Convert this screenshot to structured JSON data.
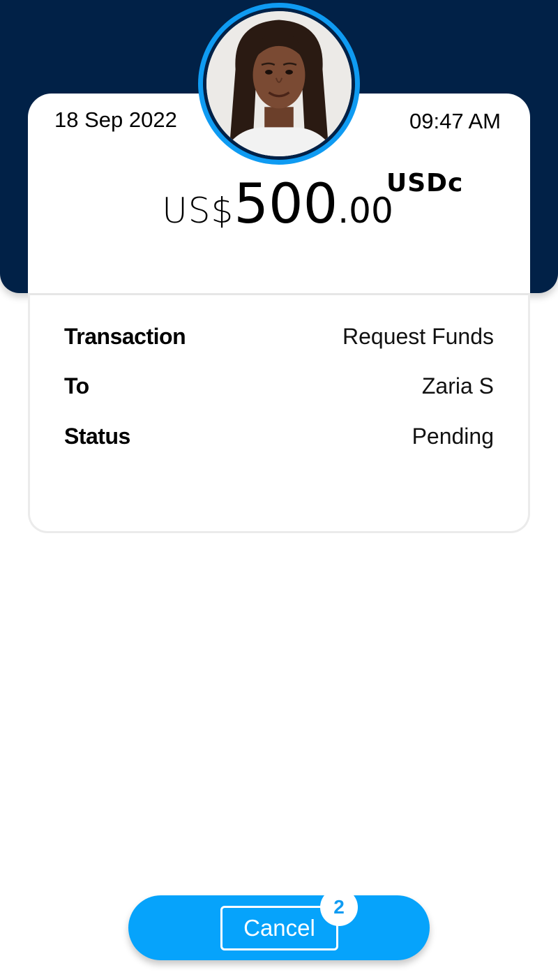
{
  "transaction_card": {
    "date": "18 Sep 2022",
    "time": "09:47 AM",
    "amount": {
      "prefix": "US$",
      "whole": "500",
      "decimal": ".00",
      "currency": "USDc"
    },
    "details": [
      {
        "label": "Transaction",
        "value": "Request Funds"
      },
      {
        "label": "To",
        "value": "Zaria S"
      },
      {
        "label": "Status",
        "value": "Pending"
      }
    ]
  },
  "footer": {
    "cancel_label": "Cancel",
    "badge_count": "2"
  },
  "colors": {
    "header": "#012147",
    "accent": "#06a3fb",
    "ring": "#0f9bf2"
  }
}
